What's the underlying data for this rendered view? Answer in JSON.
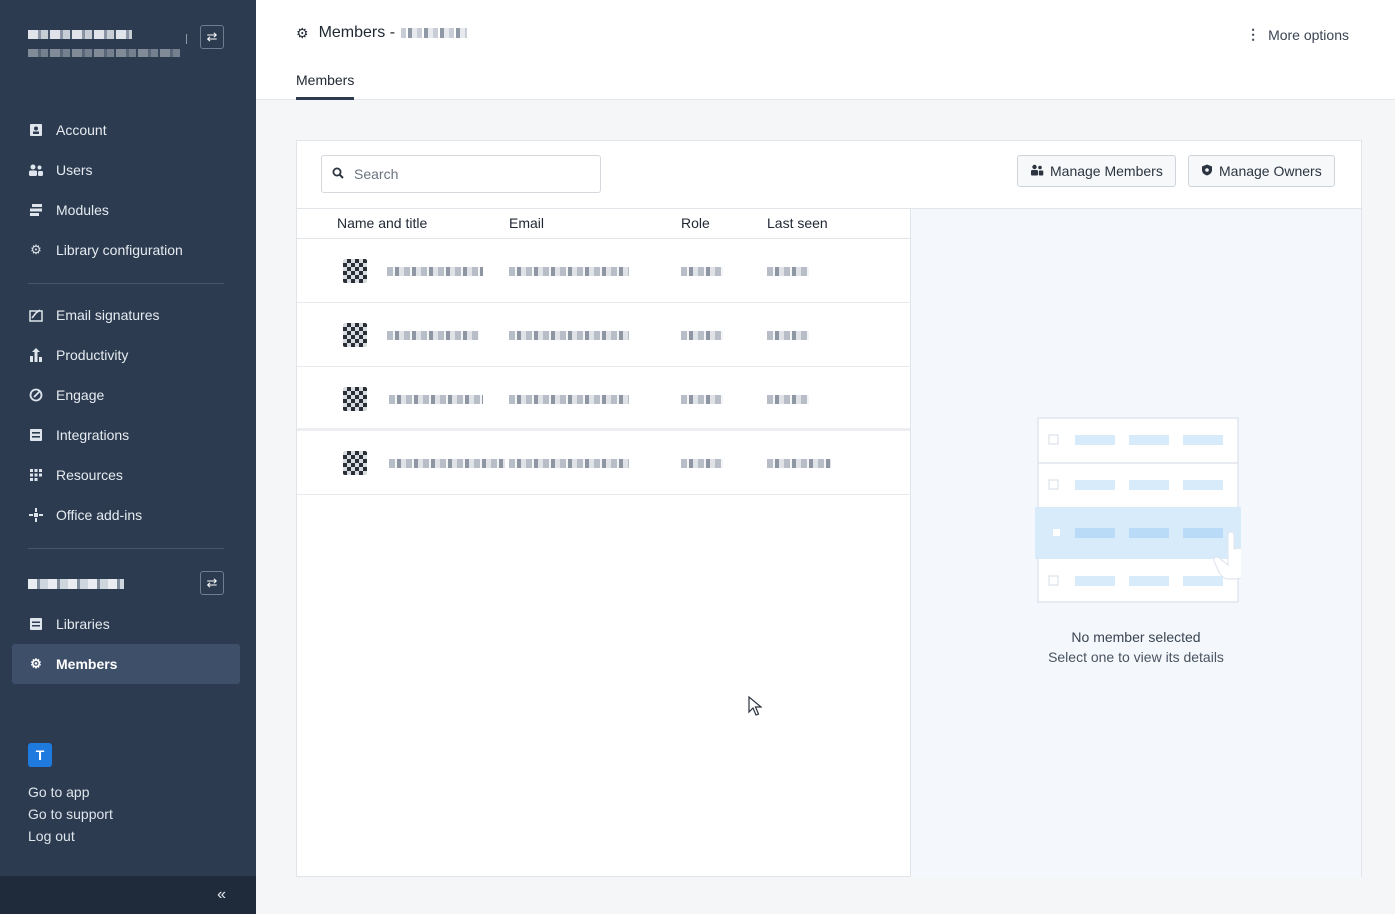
{
  "sidebar": {
    "nav_group_1": [
      {
        "label": "Account",
        "icon": "id-card-icon"
      },
      {
        "label": "Users",
        "icon": "users-icon"
      },
      {
        "label": "Modules",
        "icon": "stack-icon"
      },
      {
        "label": "Library configuration",
        "icon": "gear-icon"
      }
    ],
    "nav_group_2": [
      {
        "label": "Email signatures",
        "icon": "signature-icon"
      },
      {
        "label": "Productivity",
        "icon": "chart-icon"
      },
      {
        "label": "Engage",
        "icon": "engage-icon"
      },
      {
        "label": "Integrations",
        "icon": "integrations-icon"
      },
      {
        "label": "Resources",
        "icon": "grid-icon"
      },
      {
        "label": "Office add-ins",
        "icon": "addin-icon"
      }
    ],
    "nav_group_3": [
      {
        "label": "Libraries",
        "icon": "library-icon"
      },
      {
        "label": "Members",
        "icon": "gear-icon",
        "active": true
      }
    ],
    "brand_letter": "T",
    "footer_links": [
      "Go to app",
      "Go to support",
      "Log out"
    ],
    "collapse_glyph": "«",
    "swap_glyph": "⇄"
  },
  "header": {
    "title": "Members -",
    "more_options": "More options",
    "tab": "Members"
  },
  "toolbar": {
    "search_placeholder": "Search",
    "manage_members": "Manage Members",
    "manage_owners": "Manage Owners"
  },
  "table": {
    "columns": [
      "Name and title",
      "Email",
      "Role",
      "Last seen"
    ]
  },
  "detail": {
    "empty_title": "No member selected",
    "empty_subtitle": "Select one to view its details"
  },
  "colors": {
    "sidebar_bg": "#2c3b4f",
    "sidebar_active": "#3e5069",
    "accent": "#1f7ae0",
    "illustration_highlight": "#d8ebfb"
  }
}
